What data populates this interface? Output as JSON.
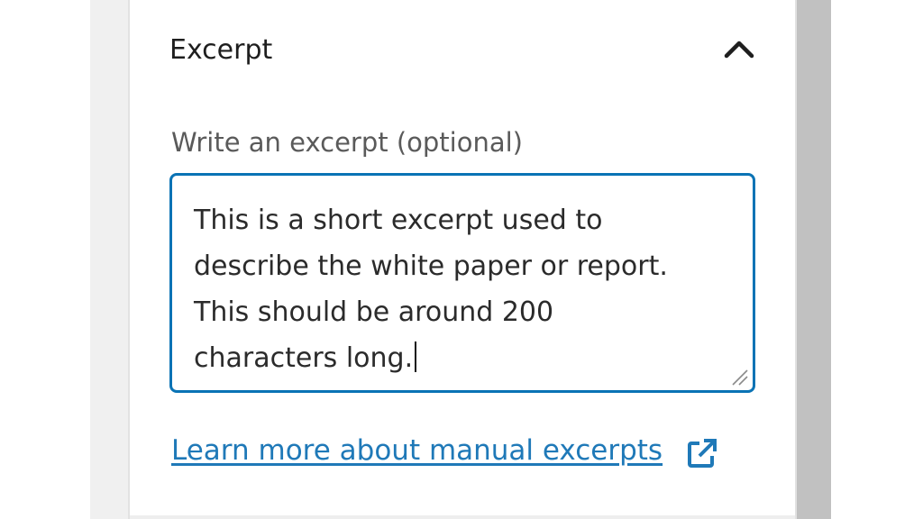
{
  "panel": {
    "title": "Excerpt",
    "expanded": true,
    "toggle_icon": "chevron-up-icon"
  },
  "excerpt": {
    "label": "Write an excerpt (optional)",
    "value_lines": [
      "This is a short excerpt used to",
      "describe the white paper or report.",
      "This should be around 200",
      "characters long."
    ],
    "focused": true
  },
  "help_link": {
    "label": "Learn more about manual excerpts",
    "icon": "external-link-icon"
  },
  "colors": {
    "accent": "#0a73b5",
    "link": "#1f79b8",
    "text": "#1e1e1e",
    "label": "#5a5a5a",
    "scrollbar": "#c1c1c1"
  }
}
